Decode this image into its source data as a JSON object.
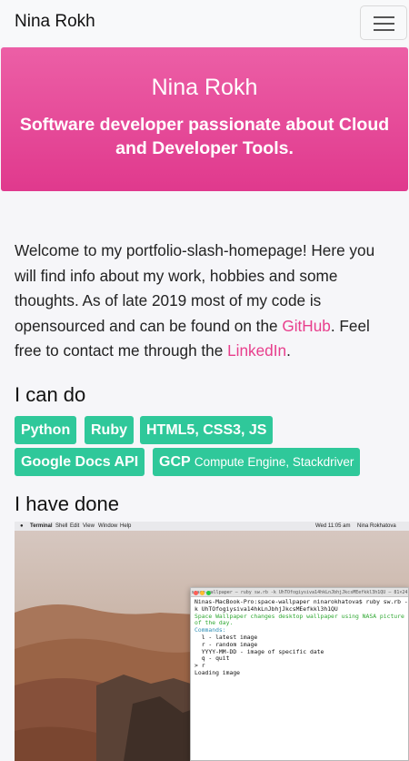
{
  "navbar": {
    "brand": "Nina Rokh",
    "menu_icon": "hamburger-menu-icon"
  },
  "hero": {
    "title": "Nina Rokh",
    "tagline_line1": "Software developer passionate about Cloud",
    "tagline_line2": "and Developer Tools."
  },
  "intro": {
    "part1": "Welcome to my portfolio-slash-homepage! Here you will find info about my work, hobbies and some thoughts. As of late 2019 most of my code is opensourced and can be found on the ",
    "github_link": "GitHub",
    "part2": ". Feel free to contact me through the ",
    "linkedin_link": "LinkedIn",
    "part3": "."
  },
  "skills": {
    "heading": "I can do",
    "tags": [
      {
        "label": "Python"
      },
      {
        "label": "Ruby"
      },
      {
        "label": "HTML5, CSS3, JS"
      },
      {
        "label": "Google Docs API"
      },
      {
        "label": "GCP",
        "detail": "Compute Engine, Stackdriver"
      }
    ]
  },
  "projects": {
    "heading": "I have done"
  },
  "screenshot": {
    "menubar": {
      "app": "Terminal",
      "items": [
        "Shell",
        "Edit",
        "View",
        "Window",
        "Help"
      ],
      "clock": "Wed 11:05 am",
      "user": "Nina Rokhatova"
    },
    "terminal": {
      "title": "space-wallpaper — ruby sw.rb -k UhTOfogiysiva14hkLnJbhjJkcsMEefkkl3h1QU — 81×24",
      "lines": [
        "Ninas-MacBook-Pro:space-wallpaper ninarokhatova$ ruby sw.rb -",
        "k UhTOfogiysiva14hkLnJbhjJkcsMEefkkl3h1QU",
        "Space Wallpaper changes desktop wallpaper using NASA picture",
        "of the day.",
        "Commands:",
        "  l - latest image",
        "  r - random image",
        "  YYYY-MM-DD - image of specific date",
        "  q - quit",
        "> r",
        "Loading image"
      ]
    }
  },
  "colors": {
    "accent_pink": "#e83e8c",
    "tag_green": "#2fc89a",
    "hero_top": "#ec5fa6",
    "hero_bottom": "#e0398d"
  }
}
